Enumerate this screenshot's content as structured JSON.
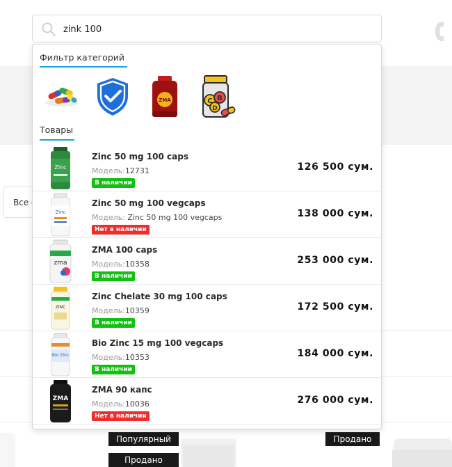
{
  "search": {
    "value": "zink 100"
  },
  "side_button": {
    "label": "Все с"
  },
  "background_tags": {
    "popular": "Популярный",
    "sold_1": "Продано",
    "sold_2": "Продано"
  },
  "dropdown": {
    "categories_title": "Фильтр категорий",
    "categories": [
      {
        "icon": "pills-icon"
      },
      {
        "icon": "shield-check-icon"
      },
      {
        "icon": "zma-bottle-icon"
      },
      {
        "icon": "vitamin-jar-icon",
        "letters": [
          "C",
          "B",
          "D"
        ]
      }
    ],
    "products_title": "Товары",
    "products": [
      {
        "name": "Zinc 50 mg 100 caps",
        "model_label": "Модель:",
        "model": "12731",
        "status": "В наличии",
        "in_stock": true,
        "price": "126 500 сум.",
        "thumb": "zinc-bottle-icon"
      },
      {
        "name": "Zinc 50 mg 100 vegcaps",
        "model_label": "Модель:",
        "model": " Zinc 50 mg 100 vegcaps",
        "status": "Нет в наличии",
        "in_stock": false,
        "price": "138 000 сум.",
        "thumb": "zinc-vegcaps-bottle-icon"
      },
      {
        "name": "ZMA 100 caps",
        "model_label": "Модель:",
        "model": "10358",
        "status": "В наличии",
        "in_stock": true,
        "price": "253 000 сум.",
        "thumb": "zma-bottle-icon"
      },
      {
        "name": "Zinc Chelate 30 mg 100 caps",
        "model_label": "Модель:",
        "model": "10359",
        "status": "В наличии",
        "in_stock": true,
        "price": "172 500 сум.",
        "thumb": "zinc-chelate-bottle-icon"
      },
      {
        "name": "Bio Zinc 15 mg 100 vegcaps",
        "model_label": "Модель:",
        "model": "10353",
        "status": "В наличии",
        "in_stock": true,
        "price": "184 000 сум.",
        "thumb": "bio-zinc-bottle-icon"
      },
      {
        "name": "ZMA 90 капс",
        "model_label": "Модель:",
        "model": "10036",
        "status": "Нет в наличии",
        "in_stock": false,
        "price": "276 000 сум.",
        "thumb": "zma-black-bottle-icon"
      }
    ]
  },
  "colors": {
    "accent": "#1aa3e0",
    "in_stock": "#12c012",
    "out_of_stock": "#ee2d2d"
  }
}
